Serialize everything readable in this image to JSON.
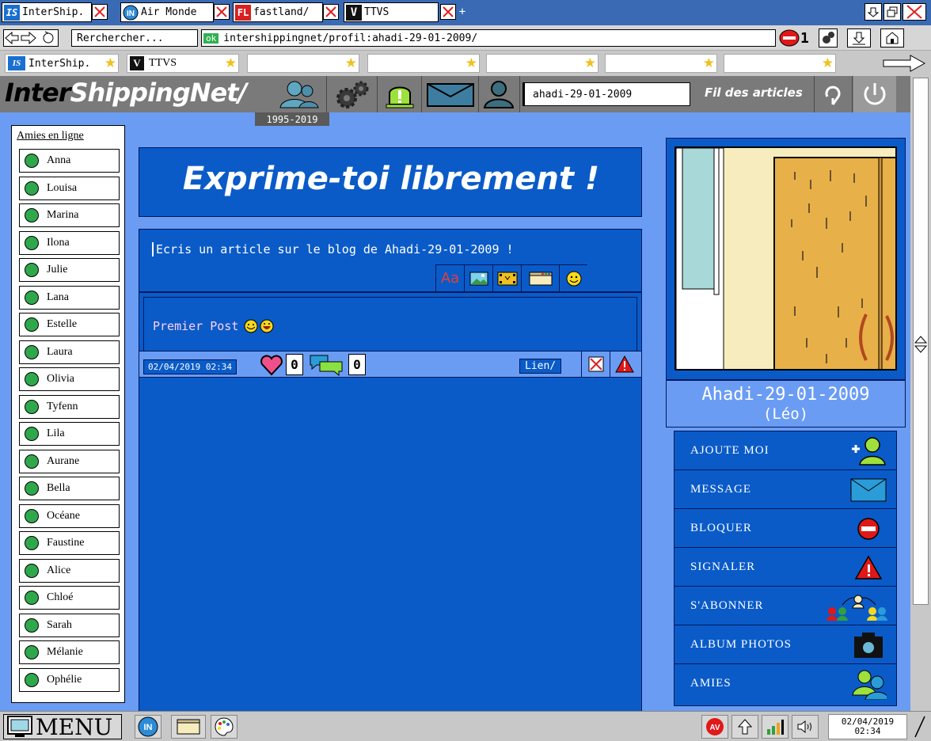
{
  "browser": {
    "tabs": [
      {
        "label": "InterShip.",
        "icon": "intership-logo-icon"
      },
      {
        "label": "Air Monde",
        "icon": "in-globe-icon"
      },
      {
        "label": "fastland/",
        "icon": "fl-logo-icon"
      },
      {
        "label": "TTVS",
        "icon": "v-logo-icon"
      }
    ],
    "new_tab": "+",
    "search_placeholder": "Rerchercher...",
    "ok_badge": "ok",
    "url": "intershippingnet/profil:ahadi-29-01-2009/",
    "block_count": "1",
    "bookmarks": [
      {
        "label": "InterShip."
      },
      {
        "label": "TTVS"
      },
      {
        "label": ""
      },
      {
        "label": ""
      },
      {
        "label": ""
      },
      {
        "label": ""
      },
      {
        "label": ""
      }
    ]
  },
  "app": {
    "logo_part1": "Inter",
    "logo_part2": "ShippingNet/",
    "year_badge": "1995-2019",
    "search_value": "ahadi-29-01-2009",
    "feed_link": "Fil des articles"
  },
  "friends": {
    "title": "Amies en ligne",
    "items": [
      "Anna",
      "Louisa",
      "Marina",
      "Ilona",
      "Julie",
      "Lana",
      "Estelle",
      "Laura",
      "Olivia",
      "Tyfenn",
      "Lila",
      "Aurane",
      "Bella",
      "Océane",
      "Faustine",
      "Alice",
      "Chloé",
      "Sarah",
      "Mélanie",
      "Ophélie"
    ],
    "status_color": "#2ea84b"
  },
  "blog": {
    "banner": "Exprime-toi librement !",
    "editor_placeholder": "Ecris un article sur le blog de Ahadi-29-01-2009 !",
    "font_tool": "Aa",
    "post": {
      "text": "Premier Post",
      "date": "02/04/2019 02:34",
      "likes": "0",
      "comments": "0",
      "link_label": "Lien/"
    }
  },
  "profile": {
    "name": "Ahadi-29-01-2009",
    "subname": "(Léo)",
    "actions": [
      {
        "label": "AJOUTE MOI",
        "icon": "add-friend-icon"
      },
      {
        "label": "MESSAGE",
        "icon": "envelope-icon"
      },
      {
        "label": "BLOQUER",
        "icon": "block-icon"
      },
      {
        "label": "SIGNALER",
        "icon": "warning-icon"
      },
      {
        "label": "S'ABONNER",
        "icon": "subscribe-icon"
      },
      {
        "label": "ALBUM PHOTOS",
        "icon": "camera-icon"
      },
      {
        "label": "AMIES",
        "icon": "friends-icon"
      }
    ]
  },
  "taskbar": {
    "menu_label": "MENU",
    "in_badge": "IN",
    "av_badge": "AV",
    "clock_date": "02/04/2019",
    "clock_time": "02:34"
  },
  "colors": {
    "accent_blue": "#0a5bc8",
    "light_blue": "#6a9cf4",
    "header_gray": "#7a7a7a"
  }
}
